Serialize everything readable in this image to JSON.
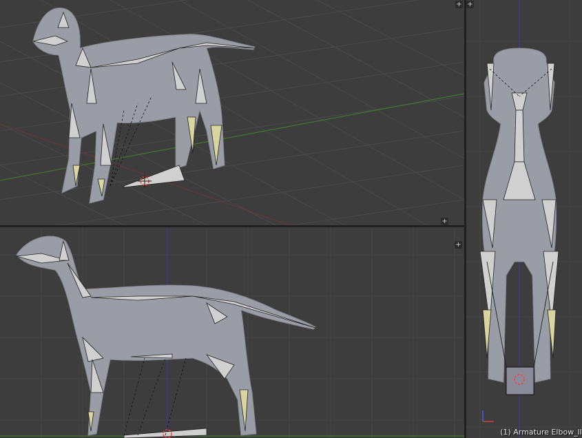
{
  "viewports": {
    "perspective": {
      "name": "perspective-viewport"
    },
    "side": {
      "name": "side-viewport"
    },
    "front": {
      "name": "front-viewport"
    }
  },
  "corner_widgets": {
    "plus_glyph": "+"
  },
  "status": {
    "object_label": "(1) Armature Elbow_lI"
  },
  "colors": {
    "viewport_bg": "#3d3d3d",
    "grid_line": "#474747",
    "mesh": "#9a9ca6",
    "bone": "#b4b6c0",
    "bone_selected": "#d8d6a0",
    "x_axis": "#7a3a3a",
    "y_axis": "#3f7a2b",
    "z_axis": "#3a3aa0"
  },
  "icons": [
    "plus-icon",
    "3d-cursor-icon",
    "axis-gizmo-icon"
  ]
}
